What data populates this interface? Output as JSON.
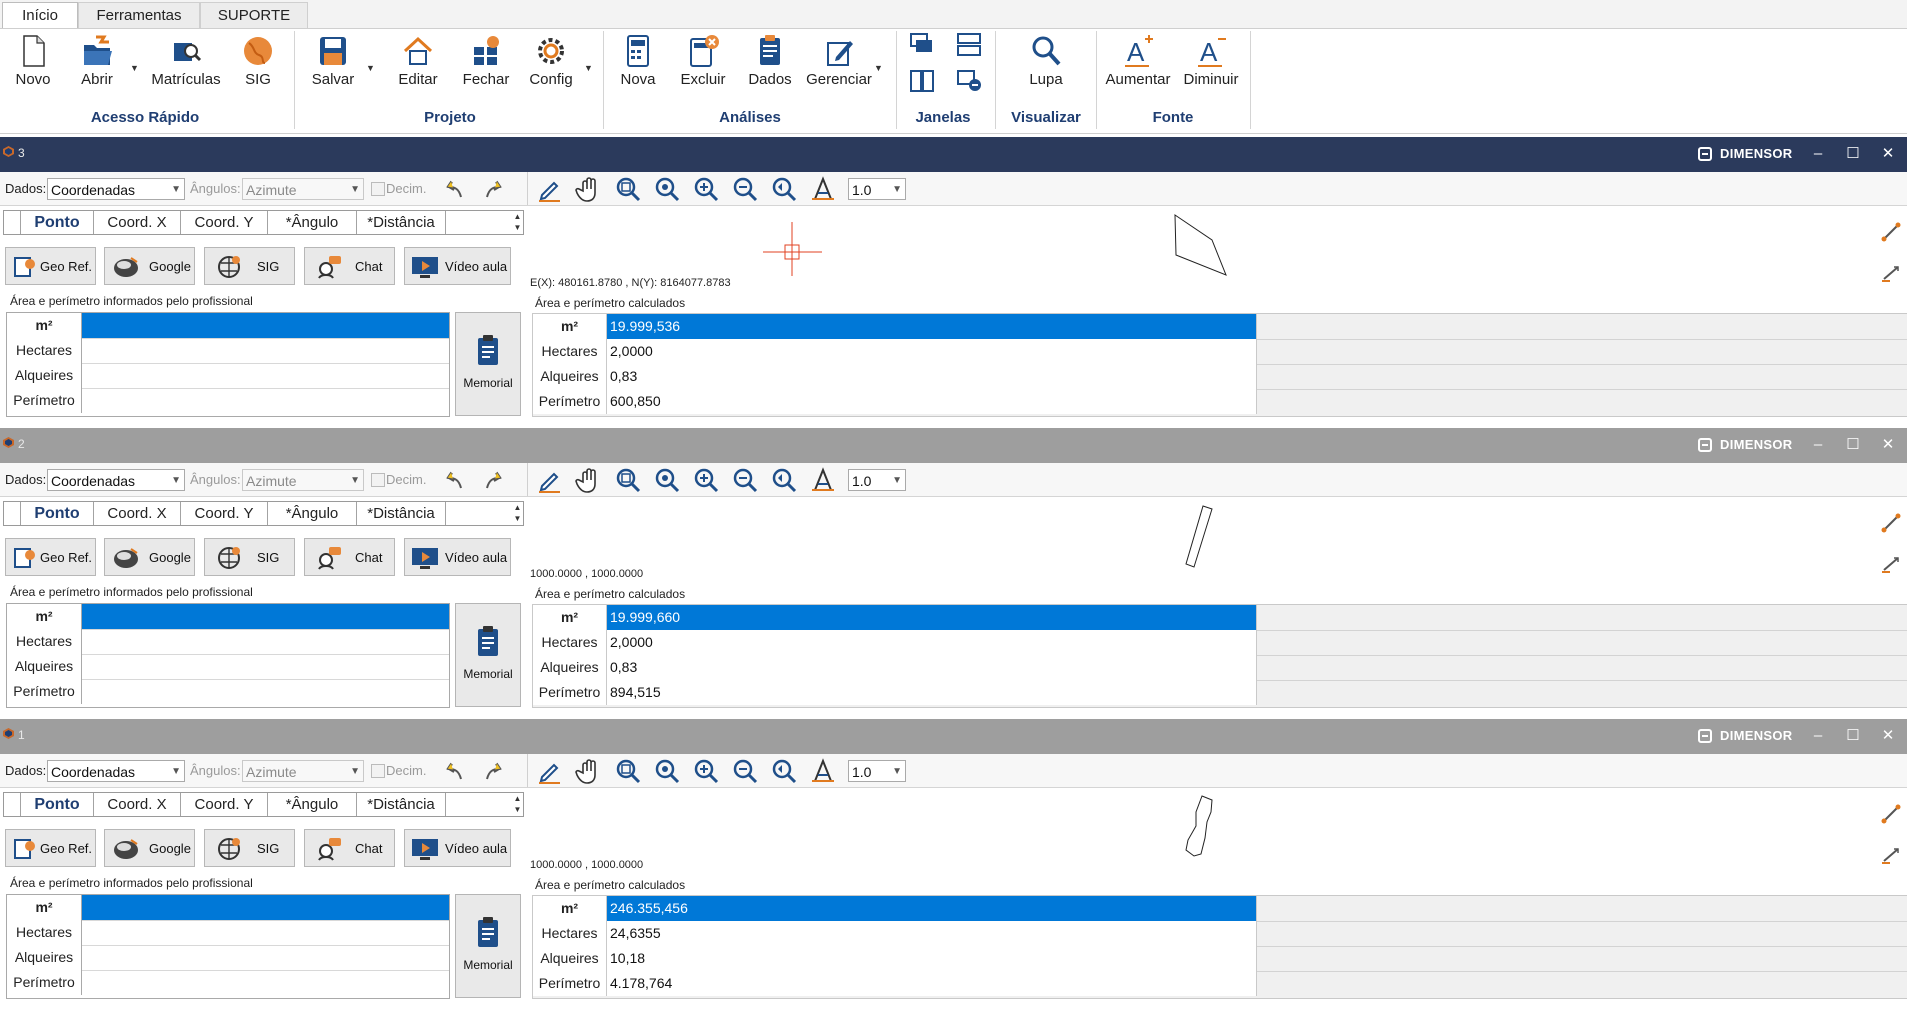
{
  "tabs": [
    "Início",
    "Ferramentas",
    "SUPORTE"
  ],
  "ribbon": {
    "buttons": {
      "novo": "Novo",
      "abrir": "Abrir",
      "matriculas": "Matrículas",
      "sig": "SIG",
      "salvar": "Salvar",
      "editar": "Editar",
      "fechar": "Fechar",
      "config": "Config",
      "nova": "Nova",
      "excluir": "Excluir",
      "dados": "Dados",
      "gerenciar": "Gerenciar",
      "lupa": "Lupa",
      "aumentar": "Aumentar",
      "diminuir": "Diminuir"
    },
    "groups": {
      "acesso_rapido": "Acesso Rápido",
      "projeto": "Projeto",
      "analises": "Análises",
      "janelas": "Janelas",
      "visualizar": "Visualizar",
      "fonte": "Fonte"
    }
  },
  "common": {
    "brand": "DIMENSOR",
    "dados_label": "Dados:",
    "dados_value": "Coordenadas",
    "angulos_label": "Ângulos:",
    "angulos_value": "Azimute",
    "decim_label": "Decim.",
    "zoom_value": "1.0",
    "columns": [
      "Ponto",
      "Coord. X",
      "Coord. Y",
      "*Ângulo",
      "*Distância"
    ],
    "action_buttons": [
      "Geo Ref.",
      "Google",
      "SIG",
      "Chat",
      "Vídeo aula"
    ],
    "informed_label": "Área e perímetro informados pelo profissional",
    "calculated_label": "Área e perímetro calculados",
    "row_keys": [
      "m²",
      "Hectares",
      "Alqueires",
      "Perímetro"
    ],
    "memorial": "Memorial"
  },
  "windows": [
    {
      "number": "3",
      "state": "active",
      "coord_readout": "E(X): 480161.8780 , N(Y): 8164077.8783",
      "calculated": [
        "19.999,536",
        "2,0000",
        "0,83",
        "600,850"
      ]
    },
    {
      "number": "2",
      "state": "inactive",
      "coord_readout": "1000.0000 , 1000.0000",
      "calculated": [
        "19.999,660",
        "2,0000",
        "0,83",
        "894,515"
      ]
    },
    {
      "number": "1",
      "state": "inactive",
      "coord_readout": "1000.0000 , 1000.0000",
      "calculated": [
        "246.355,456",
        "24,6355",
        "10,18",
        "4.178,764"
      ]
    }
  ],
  "colors": {
    "accent": "#0078d7",
    "active_titlebar": "#2b3a5c",
    "inactive_titlebar": "#9e9e9e",
    "group_label": "#1f3e72"
  }
}
